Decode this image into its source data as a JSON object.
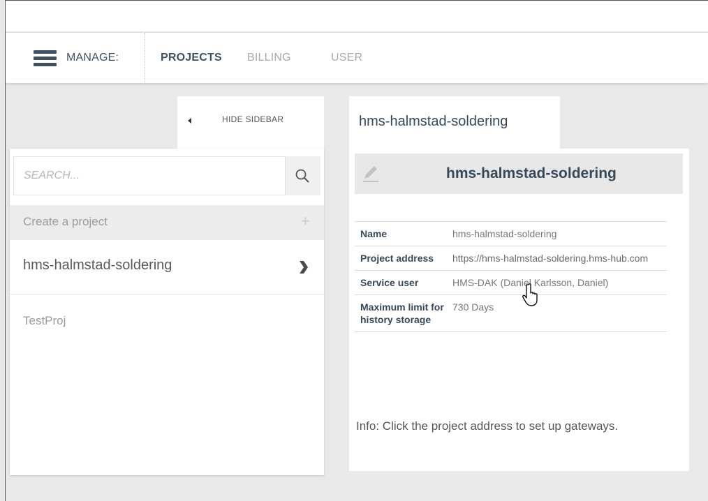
{
  "nav": {
    "manage_label": "MANAGE:",
    "tabs": [
      {
        "label": "PROJECTS",
        "active": true
      },
      {
        "label": "BILLING",
        "active": false
      },
      {
        "label": "USER",
        "active": false
      }
    ]
  },
  "sidebar": {
    "hide_label": "HIDE SIDEBAR",
    "search_placeholder": "SEARCH...",
    "create_label": "Create a project",
    "projects": [
      "hms-halmstad-soldering",
      "TestProj"
    ]
  },
  "detail": {
    "tab_label": "hms-halmstad-soldering",
    "title": "hms-halmstad-soldering",
    "rows": [
      {
        "key": "Name",
        "value": "hms-halmstad-soldering"
      },
      {
        "key": "Project address",
        "value": "https://hms-halmstad-soldering.hms-hub.com"
      },
      {
        "key": "Service user",
        "value": "HMS-DAK (Daniel Karlsson, Daniel)"
      },
      {
        "key": "Maximum limit for history storage",
        "value": "730 Days"
      }
    ],
    "info": "Info: Click the project address to set up gateways."
  },
  "colors": {
    "accent": "#3f5160",
    "background": "#e9e9ea",
    "header_bg": "#e8e8e8"
  },
  "icons": [
    "hamburger-icon",
    "caret-left-icon",
    "search-icon",
    "plus-icon",
    "chevron-right-icon",
    "pencil-icon",
    "hand-cursor-icon"
  ]
}
